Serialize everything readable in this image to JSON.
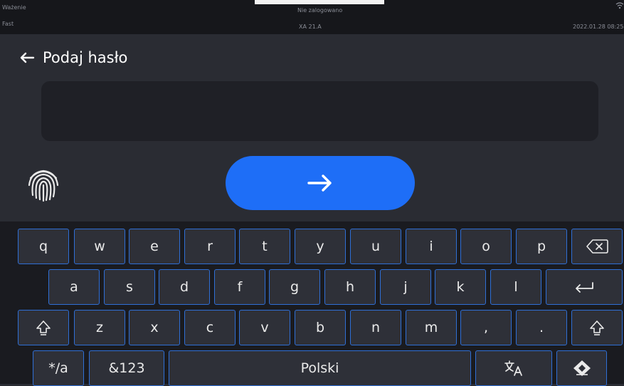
{
  "status_bar": {
    "mode_label": "Ważenie",
    "profile_label": "Fast",
    "login_status": "Nie zalogowano",
    "device_model": "XA 21.A",
    "datetime": "2022.01.28 08:25:0"
  },
  "header": {
    "title": "Podaj hasło"
  },
  "password": {
    "value": ""
  },
  "keyboard": {
    "row1": [
      "q",
      "w",
      "e",
      "r",
      "t",
      "y",
      "u",
      "i",
      "o",
      "p"
    ],
    "row2": [
      "a",
      "s",
      "d",
      "f",
      "g",
      "h",
      "j",
      "k",
      "l"
    ],
    "row3": [
      "z",
      "x",
      "c",
      "v",
      "b",
      "n",
      "m",
      ",",
      "."
    ],
    "symbols_label": "*/a",
    "numbers_label": "&123",
    "space_label": "Polski"
  },
  "colors": {
    "background": "#2a2c33",
    "status_bar": "#16171b",
    "accent": "#1e6ef7",
    "key_border": "#2f6fd6",
    "key_fill": "#2e3038"
  },
  "icons": {
    "back": "arrow-left-icon",
    "fingerprint": "fingerprint-icon",
    "confirm": "arrow-right-icon",
    "backspace": "backspace-icon",
    "enter": "enter-icon",
    "shift": "shift-icon",
    "language": "translate-icon",
    "hide_keyboard": "keyboard-hide-icon",
    "wifi": "wifi-icon"
  }
}
